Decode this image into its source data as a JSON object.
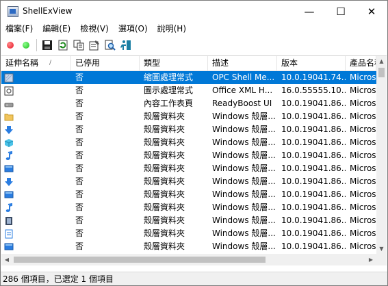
{
  "window": {
    "title": "ShellExView",
    "controls": {
      "minimize": "—",
      "maximize": "☐",
      "close": "✕"
    }
  },
  "menu": [
    {
      "label": "檔案(F)"
    },
    {
      "label": "編輯(E)"
    },
    {
      "label": "檢視(V)"
    },
    {
      "label": "選項(O)"
    },
    {
      "label": "說明(H)"
    }
  ],
  "toolbar": {
    "icons": [
      "disable-icon",
      "enable-icon",
      "save-icon",
      "refresh-icon",
      "copy-icon",
      "properties-icon",
      "find-icon",
      "exit-icon"
    ],
    "colors": {
      "red": "#e81123",
      "green": "#16b916"
    }
  },
  "list": {
    "columns": [
      "延伸名稱",
      "已停用",
      "類型",
      "描述",
      "版本",
      "產品名稱"
    ],
    "sort_indicator": "/",
    "rows": [
      {
        "icon": "shell-ext-icon",
        "disabled": "否",
        "type": "縮圖處理常式",
        "description": "OPC Shell Me...",
        "version": "10.0.19041.74...",
        "product": "Microsoft",
        "selected": true
      },
      {
        "icon": "xml-icon",
        "disabled": "否",
        "type": "圖示處理常式",
        "description": "Office XML H...",
        "version": "16.0.55555.10...",
        "product": "Microsoft"
      },
      {
        "icon": "drive-icon",
        "disabled": "否",
        "type": "內容工作表頁",
        "description": "ReadyBoost UI",
        "version": "10.0.19041.86...",
        "product": "Microsoft"
      },
      {
        "icon": "folder-icon",
        "disabled": "否",
        "type": "殼層資料夾",
        "description": "Windows 殼層...",
        "version": "10.0.19041.86...",
        "product": "Microsoft"
      },
      {
        "icon": "download-icon",
        "disabled": "否",
        "type": "殼層資料夾",
        "description": "Windows 殼層...",
        "version": "10.0.19041.86...",
        "product": "Microsoft"
      },
      {
        "icon": "3d-objects-icon",
        "disabled": "否",
        "type": "殼層資料夾",
        "description": "Windows 殼層...",
        "version": "10.0.19041.86...",
        "product": "Microsoft"
      },
      {
        "icon": "music-icon",
        "disabled": "否",
        "type": "殼層資料夾",
        "description": "Windows 殼層...",
        "version": "10.0.19041.86...",
        "product": "Microsoft"
      },
      {
        "icon": "desktop-icon",
        "disabled": "否",
        "type": "殼層資料夾",
        "description": "Windows 殼層...",
        "version": "10.0.19041.86...",
        "product": "Microsoft"
      },
      {
        "icon": "download-icon",
        "disabled": "否",
        "type": "殼層資料夾",
        "description": "Windows 殼層...",
        "version": "10.0.19041.86...",
        "product": "Microsoft"
      },
      {
        "icon": "desktop-icon",
        "disabled": "否",
        "type": "殼層資料夾",
        "description": "Windows 殼層...",
        "version": "10.0.19041.86...",
        "product": "Microsoft"
      },
      {
        "icon": "music-icon",
        "disabled": "否",
        "type": "殼層資料夾",
        "description": "Windows 殼層...",
        "version": "10.0.19041.86...",
        "product": "Microsoft"
      },
      {
        "icon": "video-icon",
        "disabled": "否",
        "type": "殼層資料夾",
        "description": "Windows 殼層...",
        "version": "10.0.19041.86...",
        "product": "Microsoft"
      },
      {
        "icon": "document-icon",
        "disabled": "否",
        "type": "殼層資料夾",
        "description": "Windows 殼層...",
        "version": "10.0.19041.86...",
        "product": "Microsoft"
      },
      {
        "icon": "desktop-icon",
        "disabled": "否",
        "type": "殼層資料夾",
        "description": "Windows 殼層...",
        "version": "10.0.19041.86...",
        "product": "Microsoft"
      }
    ]
  },
  "status": {
    "text": "286 個項目，已選定 1 個項目"
  }
}
